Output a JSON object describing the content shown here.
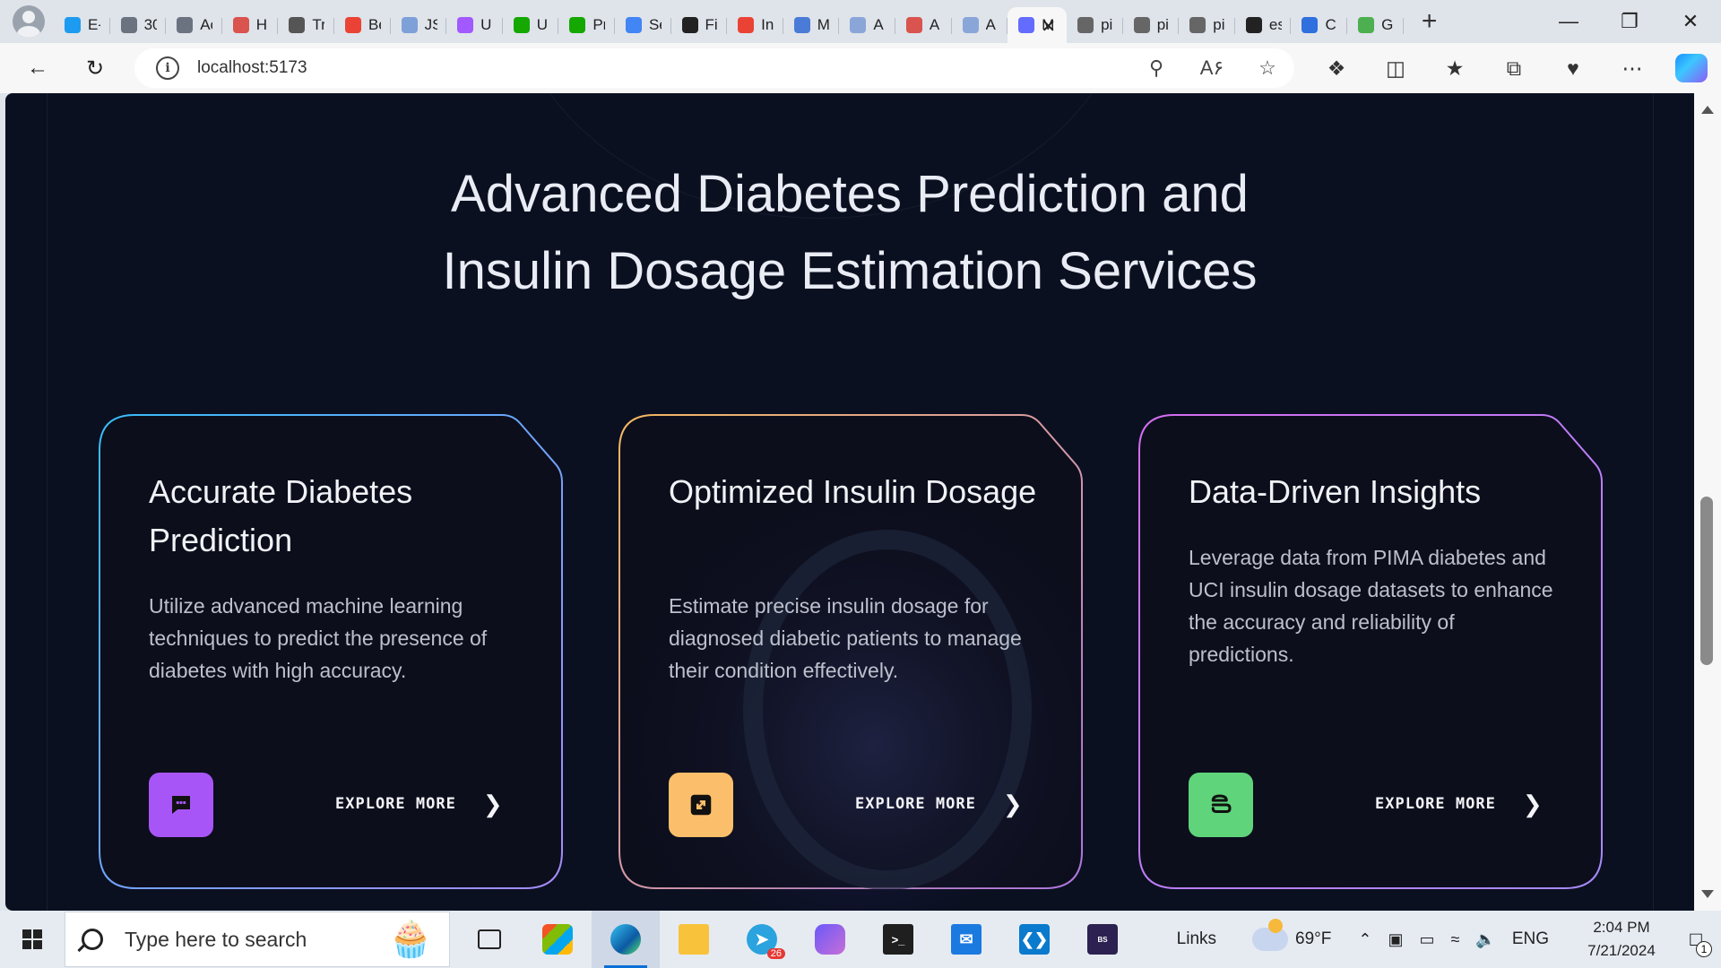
{
  "browser": {
    "tabs": [
      {
        "label": "E-",
        "icon": "twitter-bird-icon",
        "color": "#1d9bf0"
      },
      {
        "label": "30",
        "icon": "loader-icon",
        "color": "#6b7280"
      },
      {
        "label": "Ac",
        "icon": "loader-icon",
        "color": "#6b7280"
      },
      {
        "label": "H",
        "icon": "pdf-icon",
        "color": "#d9534f"
      },
      {
        "label": "Tr",
        "icon": "medium-icon",
        "color": "#555555"
      },
      {
        "label": "Be",
        "icon": "gmail-icon",
        "color": "#ea4335"
      },
      {
        "label": "JS",
        "icon": "document-icon",
        "color": "#7da0d8"
      },
      {
        "label": "U",
        "icon": "figma-icon",
        "color": "#a259ff"
      },
      {
        "label": "U",
        "icon": "upwork-icon",
        "color": "#14a800"
      },
      {
        "label": "Pr",
        "icon": "upwork-icon",
        "color": "#14a800"
      },
      {
        "label": "Se",
        "icon": "google-icon",
        "color": "#4285f4"
      },
      {
        "label": "Fi",
        "icon": "chatgpt-icon",
        "color": "#222222"
      },
      {
        "label": "In",
        "icon": "gmail-icon",
        "color": "#ea4335"
      },
      {
        "label": "M",
        "icon": "docs-icon",
        "color": "#4a7bd6"
      },
      {
        "label": "A",
        "icon": "docs-icon",
        "color": "#8aa6d8"
      },
      {
        "label": "A",
        "icon": "pdf-icon",
        "color": "#d9534f"
      },
      {
        "label": "A",
        "icon": "docs-icon",
        "color": "#8aa6d8"
      },
      {
        "label": "M",
        "icon": "vite-icon",
        "color": "#646cff",
        "active": true
      },
      {
        "label": "pi",
        "icon": "file-icon",
        "color": "#666666"
      },
      {
        "label": "pi",
        "icon": "file-icon",
        "color": "#666666"
      },
      {
        "label": "pi",
        "icon": "file-icon",
        "color": "#666666"
      },
      {
        "label": "es",
        "icon": "github-icon",
        "color": "#222222"
      },
      {
        "label": "C",
        "icon": "docs-icon",
        "color": "#2f6fde"
      },
      {
        "label": "G",
        "icon": "image-icon",
        "color": "#4caf50"
      }
    ],
    "url": "localhost:5173"
  },
  "page": {
    "heading_line1": "Advanced Diabetes Prediction and",
    "heading_line2": "Insulin Dosage Estimation Services",
    "cards": [
      {
        "title": "Accurate Diabetes Prediction",
        "description": "Utilize advanced machine learning techniques to predict the presence of diabetes with high accuracy.",
        "link": "EXPLORE MORE",
        "icon": "chat-bubble-icon",
        "icon_color": "#a855f7",
        "border_from": "#38bdf8",
        "border_to": "#a78bfa"
      },
      {
        "title": "Optimized Insulin Dosage",
        "description": "Estimate precise insulin dosage for diagnosed diabetic patients to manage their condition effectively.",
        "link": "EXPLORE MORE",
        "icon": "expand-arrows-icon",
        "icon_color": "#fbbf6b",
        "border_from": "#f4b860",
        "border_to": "#b57be8"
      },
      {
        "title": "Data-Driven Insights",
        "description": "Leverage data from PIMA diabetes and UCI insulin dosage datasets to enhance the accuracy and reliability of predictions.",
        "link": "EXPLORE MORE",
        "icon": "database-icon",
        "icon_color": "#5fd47a",
        "border_from": "#d56df0",
        "border_to": "#a78bfa"
      }
    ]
  },
  "taskbar": {
    "search_placeholder": "Type here to search",
    "links_label": "Links",
    "temperature": "69°F",
    "language": "ENG",
    "time": "2:04 PM",
    "date": "7/21/2024",
    "telegram_badge": "26",
    "notification_count": "1"
  }
}
